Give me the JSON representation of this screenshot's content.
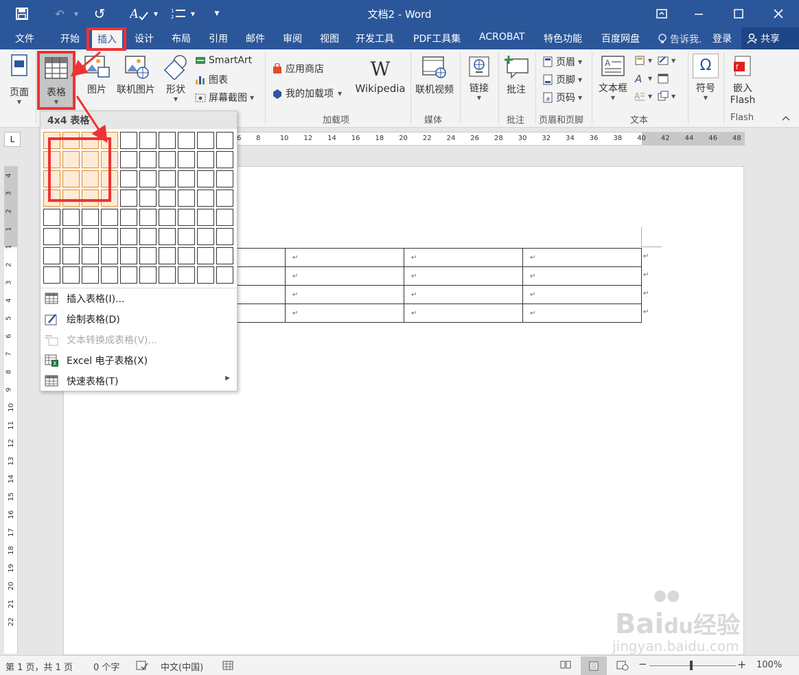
{
  "titlebar": {
    "title": "文档2 - Word",
    "undo_glyph": "↶",
    "redo_glyph": "↺",
    "customize_glyph": "▼"
  },
  "tabs": [
    "文件",
    "开始",
    "插入",
    "设计",
    "布局",
    "引用",
    "邮件",
    "审阅",
    "视图",
    "开发工具",
    "PDF工具集",
    "ACROBAT",
    "特色功能",
    "百度网盘"
  ],
  "active_tab": "插入",
  "tellme": "告诉我.",
  "login": "登录",
  "share": "共享",
  "ribbon": {
    "page_btn": "页面",
    "table_btn": "表格",
    "picture_btn": "图片",
    "online_picture_btn": "联机图片",
    "shapes_btn": "形状",
    "smartart": "SmartArt",
    "chart": "图表",
    "screenshot": "屏幕截图",
    "store": "应用商店",
    "my_addins": "我的加载项",
    "wikipedia": "Wikipedia",
    "wikipedia_logo": "W",
    "addins_group": "加载项",
    "online_video": "联机视频",
    "media_group": "媒体",
    "link": "链接",
    "comment": "批注",
    "comment_group": "批注",
    "header": "页眉",
    "footer": "页脚",
    "page_number": "页码",
    "header_footer_group": "页眉和页脚",
    "textbox": "文本框",
    "text_group": "文本",
    "symbol": "符号",
    "symbol_glyph": "Ω",
    "embed_flash_line1": "嵌入",
    "embed_flash_line2": "Flash",
    "flash_group": "Flash"
  },
  "dropdown": {
    "header": "4x4 表格",
    "grid_cols": 10,
    "grid_rows": 8,
    "highlight_cols": 4,
    "highlight_rows": 4,
    "items": [
      {
        "label": "插入表格(I)...",
        "enabled": true
      },
      {
        "label": "绘制表格(D)",
        "enabled": true
      },
      {
        "label": "文本转换成表格(V)...",
        "enabled": false
      },
      {
        "label": "Excel 电子表格(X)",
        "enabled": true
      },
      {
        "label": "快速表格(T)",
        "enabled": true,
        "submenu": true
      }
    ]
  },
  "ruler_h_labels": [
    "6",
    "8",
    "10",
    "12",
    "14",
    "16",
    "18",
    "20",
    "22",
    "24",
    "26",
    "28",
    "30",
    "32",
    "34",
    "36",
    "38",
    "40",
    "42",
    "44",
    "46",
    "48"
  ],
  "ruler_v_labels": [
    "4",
    "3",
    "2",
    "1",
    "1",
    "2",
    "3",
    "4",
    "5",
    "6",
    "7",
    "8",
    "9",
    "10",
    "11",
    "12",
    "13",
    "14",
    "15",
    "16",
    "17",
    "18",
    "19",
    "20",
    "21",
    "22"
  ],
  "ruler_corner": "L",
  "doc_table": {
    "rows": 4,
    "cols": 4,
    "cell_mark": "↵"
  },
  "statusbar": {
    "page": "第 1 页，共 1 页",
    "words": "0 个字",
    "lang": "中文(中国)",
    "zoom": "100%",
    "zoom_minus": "−",
    "zoom_plus": "+"
  },
  "watermark": {
    "line1_a": "Bai",
    "line1_b": "du",
    "line1_c": "经验",
    "line2": "jingyan.baidu.com"
  },
  "colors": {
    "brand": "#2b579a",
    "annotation": "#ee3333",
    "grid_highlight": "#e08a2c"
  }
}
